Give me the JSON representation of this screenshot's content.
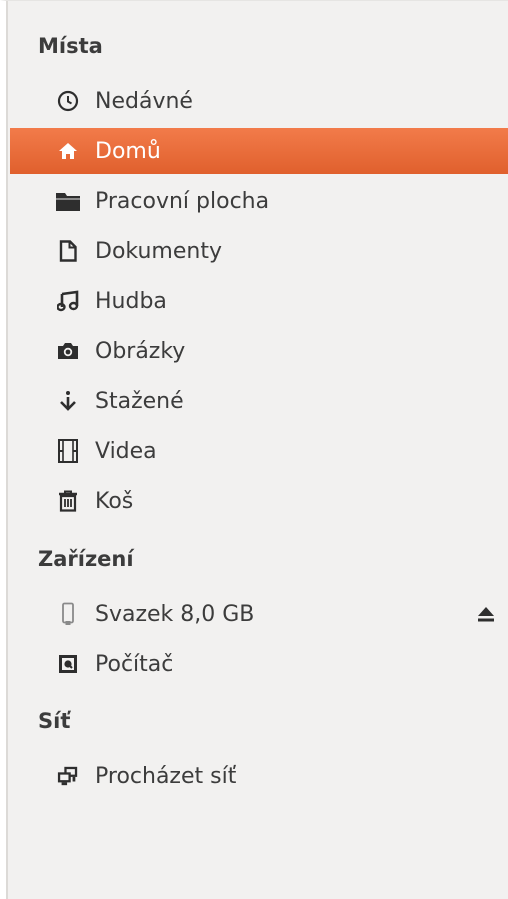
{
  "places": {
    "header": "Místa",
    "items": [
      {
        "label": "Nedávné",
        "icon": "clock-icon"
      },
      {
        "label": "Domů",
        "icon": "home-icon",
        "selected": true
      },
      {
        "label": "Pracovní plocha",
        "icon": "folder-icon"
      },
      {
        "label": "Dokumenty",
        "icon": "document-icon"
      },
      {
        "label": "Hudba",
        "icon": "music-icon"
      },
      {
        "label": "Obrázky",
        "icon": "camera-icon"
      },
      {
        "label": "Stažené",
        "icon": "download-icon"
      },
      {
        "label": "Videa",
        "icon": "film-icon"
      },
      {
        "label": "Koš",
        "icon": "trash-icon"
      }
    ]
  },
  "devices": {
    "header": "Zařízení",
    "items": [
      {
        "label": "Svazek 8,0 GB",
        "icon": "usb-drive-icon",
        "eject": "eject-icon"
      },
      {
        "label": "Počítač",
        "icon": "computer-icon"
      }
    ]
  },
  "network": {
    "header": "Síť",
    "items": [
      {
        "label": "Procházet síť",
        "icon": "network-icon"
      }
    ]
  },
  "colors": {
    "selected_bg": "#e96a39",
    "text": "#3c3c3c",
    "background": "#f2f1f0"
  }
}
